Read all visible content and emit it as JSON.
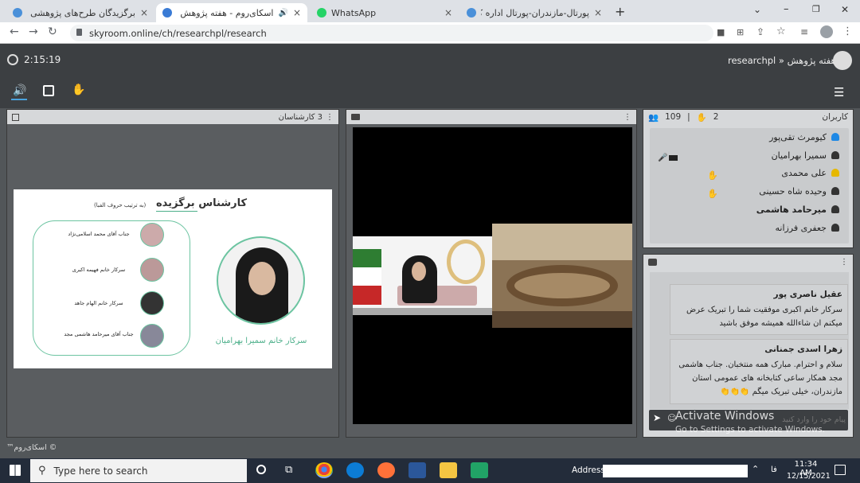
{
  "browser": {
    "tabs": [
      {
        "label": "برگزیدگان طرح‌های پژوهشی و فعالیت",
        "close": "×"
      },
      {
        "label": "اسکای‌روم - هفته پژوهش",
        "close": "×"
      },
      {
        "label": "WhatsApp",
        "close": "×"
      },
      {
        "label": "پورتال-مازندران-پورتال اداره کل کتابخ",
        "close": "×"
      }
    ],
    "new_tab": "+",
    "url": "skyroom.online/ch/researchpl/research",
    "window_controls": [
      "⌄",
      "–",
      "❐",
      "✕"
    ]
  },
  "app": {
    "timer": "2:15:19",
    "room_path": "researchpl » هفته پژوهش",
    "brand": "™اسکای‌روم ©"
  },
  "presentation": {
    "count_label": "3 کارشناسان",
    "slide": {
      "title": "کارشناس برگزیده",
      "subtitle": "(به ترتیب حروف الفبا)",
      "winner_name": "سرکار خانم سمیرا بهرامیان",
      "people": [
        "جناب آقای محمد اسلامی‌نژاد",
        "سرکار خانم فهیمه اکبری",
        "سرکار خانم الهام جاهد",
        "جناب آقای میرحامد هاشمی مجد"
      ]
    }
  },
  "users": {
    "title": "کاربران",
    "count": "109",
    "hands": "2",
    "list": [
      {
        "name": "کیومرث تقی‌پور",
        "color": "#1e88e5"
      },
      {
        "name": "سمیرا بهرامیان",
        "color": "#333333"
      },
      {
        "name": "علی محمدی",
        "color": "#e6b800"
      },
      {
        "name": "وحیده شاه حسینی",
        "color": "#333333"
      },
      {
        "name": "میرحامد هاشمی",
        "color": "#333333"
      },
      {
        "name": "جعفری فرزانه",
        "color": "#333333"
      }
    ]
  },
  "chat": {
    "messages": [
      {
        "author": "عقیل ناصری پور",
        "text": "سرکار خانم اکبری موفقیت شما را تبریک عرض میکنم ان شاءالله همیشه موفق باشید"
      },
      {
        "author": "زهرا اسدی جمنانی",
        "text": "سلام و احترام. مبارک همه منتخبان. جناب هاشمی مجد همکار ساعی کتابخانه های عمومی استان مازندران، خیلی تبریک میگم 👏👏👏"
      }
    ],
    "input_placeholder": "پیام خود را وارد کنید",
    "activate_title": "Activate Windows",
    "activate_sub": "Go to Settings to activate Windows."
  },
  "taskbar": {
    "search_placeholder": "Type here to search",
    "address_label": "Address",
    "lang": "فا",
    "time": "11:34 AM",
    "date": "12/15/2021"
  }
}
